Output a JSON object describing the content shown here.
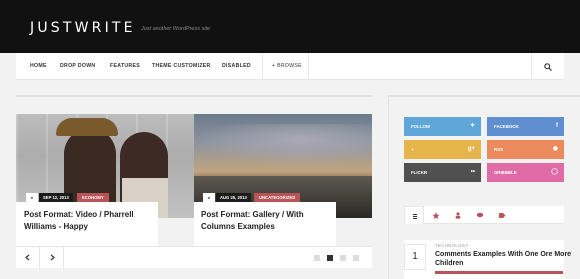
{
  "site": {
    "title": "JUSTWRITE",
    "tagline": "Just another WordPress site"
  },
  "nav": {
    "items": [
      "HOME",
      "DROP DOWN",
      "FEATURES",
      "THEME CUSTOMIZER",
      "DISABLED"
    ],
    "browse": "+ BROWSE",
    "search_icon": "search-icon"
  },
  "slides": [
    {
      "date": "SEP 12, 2013",
      "category": "ECONOMY",
      "title": "Post Format: Video / Pharrell Williams - Happy",
      "format_icon": "video-icon"
    },
    {
      "date": "AUG 25, 2013",
      "category": "UNCATEGORIZED",
      "title": "Post Format: Gallery / With Columns Examples",
      "format_icon": "gallery-icon"
    }
  ],
  "slider": {
    "prev_icon": "chevron-left-icon",
    "next_icon": "chevron-right-icon",
    "dots": 4,
    "active_dot": 1
  },
  "social": [
    {
      "label": "FOLLOW",
      "icon": "twitter-icon",
      "color": "#5fa7d9"
    },
    {
      "label": "FACEBOOK",
      "icon": "facebook-icon",
      "color": "#5f8fd1"
    },
    {
      "label": "+",
      "icon": "google-plus-icon",
      "color": "#e5b44a"
    },
    {
      "label": "RSS",
      "icon": "rss-icon",
      "color": "#eb8a5c"
    },
    {
      "label": "FLICKR",
      "icon": "flickr-icon",
      "color": "#505050"
    },
    {
      "label": "DRIBBBLE",
      "icon": "dribbble-icon",
      "color": "#e06ba7"
    }
  ],
  "tabs": [
    "list-icon",
    "star-icon",
    "user-icon",
    "comments-icon",
    "tags-icon"
  ],
  "popular": {
    "number": "1",
    "category": "TECHNOLOGY",
    "title": "Comments Examples With One Ore More Children"
  },
  "colors": {
    "accent": "#b85456",
    "header_bg": "#111111"
  }
}
